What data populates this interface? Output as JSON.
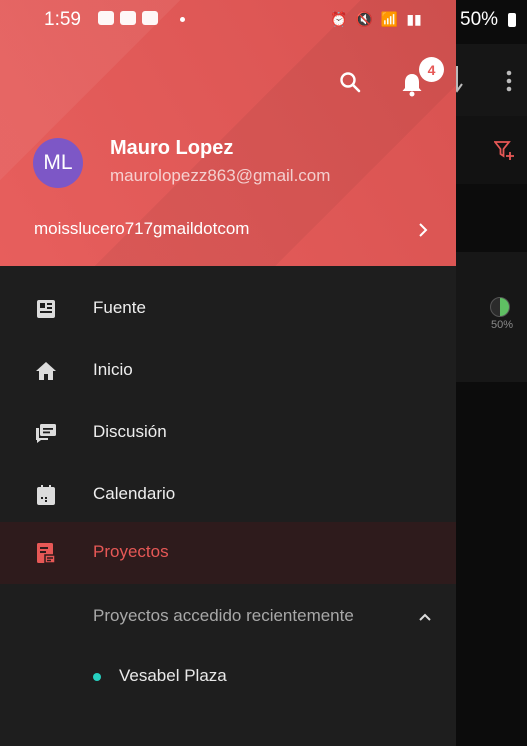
{
  "status_bar": {
    "time": "1:59",
    "battery": "50%"
  },
  "header": {
    "notification_count": "4",
    "avatar_initials": "ML",
    "user_name": "Mauro Lopez",
    "user_email": "maurolopezz863@gmail.com",
    "account": "moisslucero717gmaildotcom"
  },
  "menu": {
    "items": [
      {
        "label": "Fuente",
        "icon": "feed-icon"
      },
      {
        "label": "Inicio",
        "icon": "home-icon"
      },
      {
        "label": "Discusión",
        "icon": "discussion-icon"
      },
      {
        "label": "Calendario",
        "icon": "calendar-icon"
      },
      {
        "label": "Proyectos",
        "icon": "projects-icon",
        "active": true
      }
    ],
    "recent_header": "Proyectos accedido recientemente",
    "recent_projects": [
      {
        "label": "Vesabel Plaza",
        "dot_color": "#26d0c0"
      }
    ]
  },
  "background": {
    "progress_percent": "50%",
    "progress_value": 0.5
  },
  "colors": {
    "accent": "#e65856",
    "drawer_bg": "#1e1e1e",
    "avatar": "#7d57c6",
    "active_bg": "#2e1b1c"
  }
}
